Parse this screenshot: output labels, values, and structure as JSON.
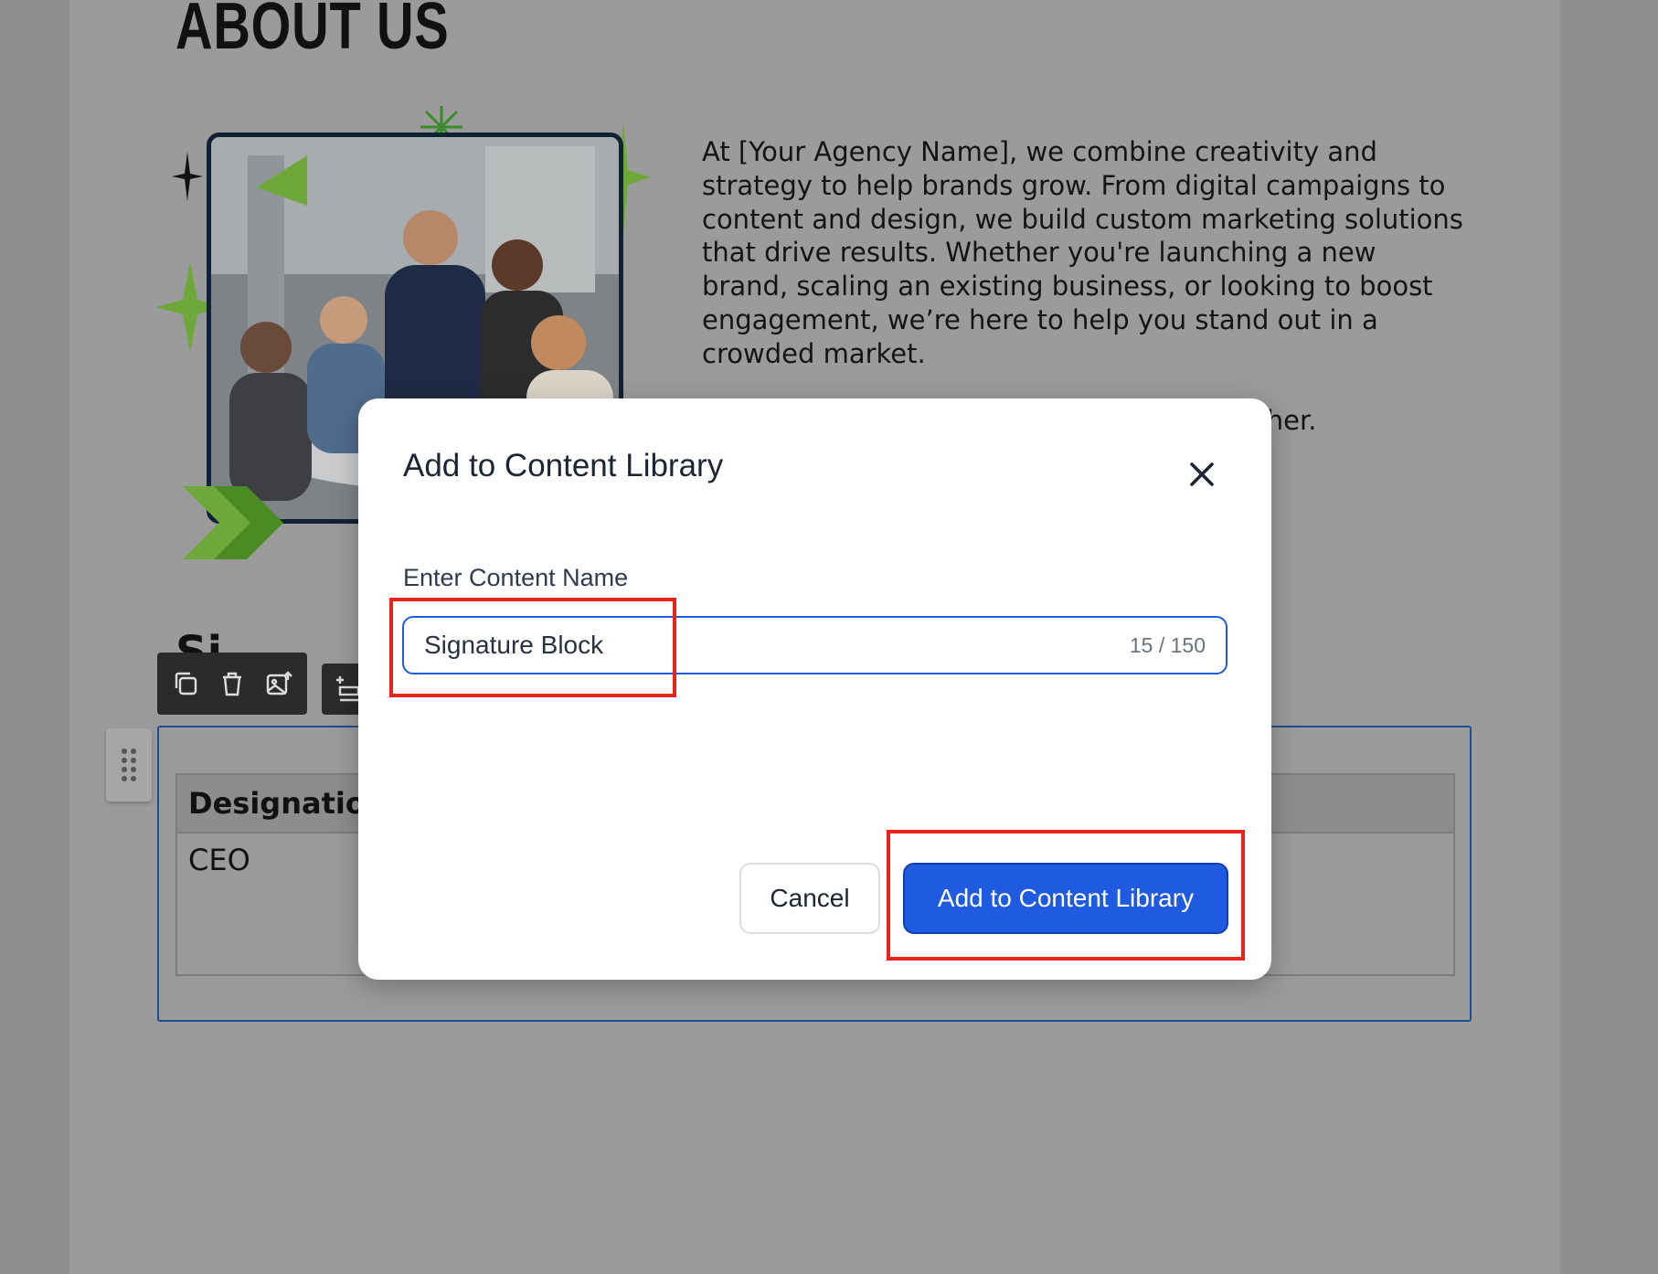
{
  "document": {
    "heading": "ABOUT US",
    "paragraphs": [
      "At [Your Agency Name], we combine creativity and strategy to help brands grow. From digital campaigns to content and design, we build custom marketing solutions that drive results.  Whether you're launching a new brand, scaling an existing business, or looking to boost engagement, we’re here to help you stand out in a crowded market.",
      "Your success is our focus—let’s grow together."
    ],
    "table": {
      "header": "Designation",
      "cell": "CEO"
    }
  },
  "modal": {
    "title": "Add to Content Library",
    "field_label": "Enter Content Name",
    "input_value": "Signature Block",
    "char_count": "15 / 150",
    "cancel_label": "Cancel",
    "submit_label": "Add to Content Library"
  },
  "colors": {
    "primary": "#1f5be0",
    "highlight": "#e8231a",
    "accent_green": "#6fa83a"
  }
}
